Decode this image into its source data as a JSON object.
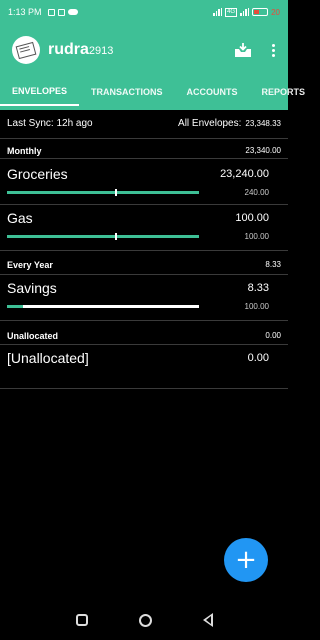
{
  "status_bar": {
    "time": "1:13 PM",
    "battery_text": "20"
  },
  "app": {
    "title": "rudra",
    "title_suffix": "2913"
  },
  "tabs": [
    {
      "label": "ENVELOPES",
      "active": true
    },
    {
      "label": "TRANSACTIONS",
      "active": false
    },
    {
      "label": "ACCOUNTS",
      "active": false
    },
    {
      "label": "REPORTS",
      "active": false
    }
  ],
  "sync": {
    "label": "Last Sync: 12h ago",
    "all_label": "All Envelopes:",
    "all_value": "23,348.33"
  },
  "sections": [
    {
      "name": "Monthly",
      "total": "23,340.00",
      "envelopes": [
        {
          "name": "Groceries",
          "balance": "23,240.00",
          "budget": "240.00",
          "progress": 1.0
        },
        {
          "name": "Gas",
          "balance": "100.00",
          "budget": "100.00",
          "progress": 1.0
        }
      ]
    },
    {
      "name": "Every Year",
      "total": "8.33",
      "envelopes": [
        {
          "name": "Savings",
          "balance": "8.33",
          "budget": "100.00",
          "progress": 0.0833
        }
      ]
    },
    {
      "name": "Unallocated",
      "total": "0.00",
      "envelopes": [
        {
          "name": "[Unallocated]",
          "balance": "0.00"
        }
      ]
    }
  ],
  "colors": {
    "accent": "#3ec096",
    "fab": "#2196f3",
    "background": "#000000"
  },
  "icons": {
    "logo": "envelope-logo-icon",
    "inbox": "inbox-download-icon",
    "menu": "more-vert-icon",
    "fab": "add-icon"
  }
}
